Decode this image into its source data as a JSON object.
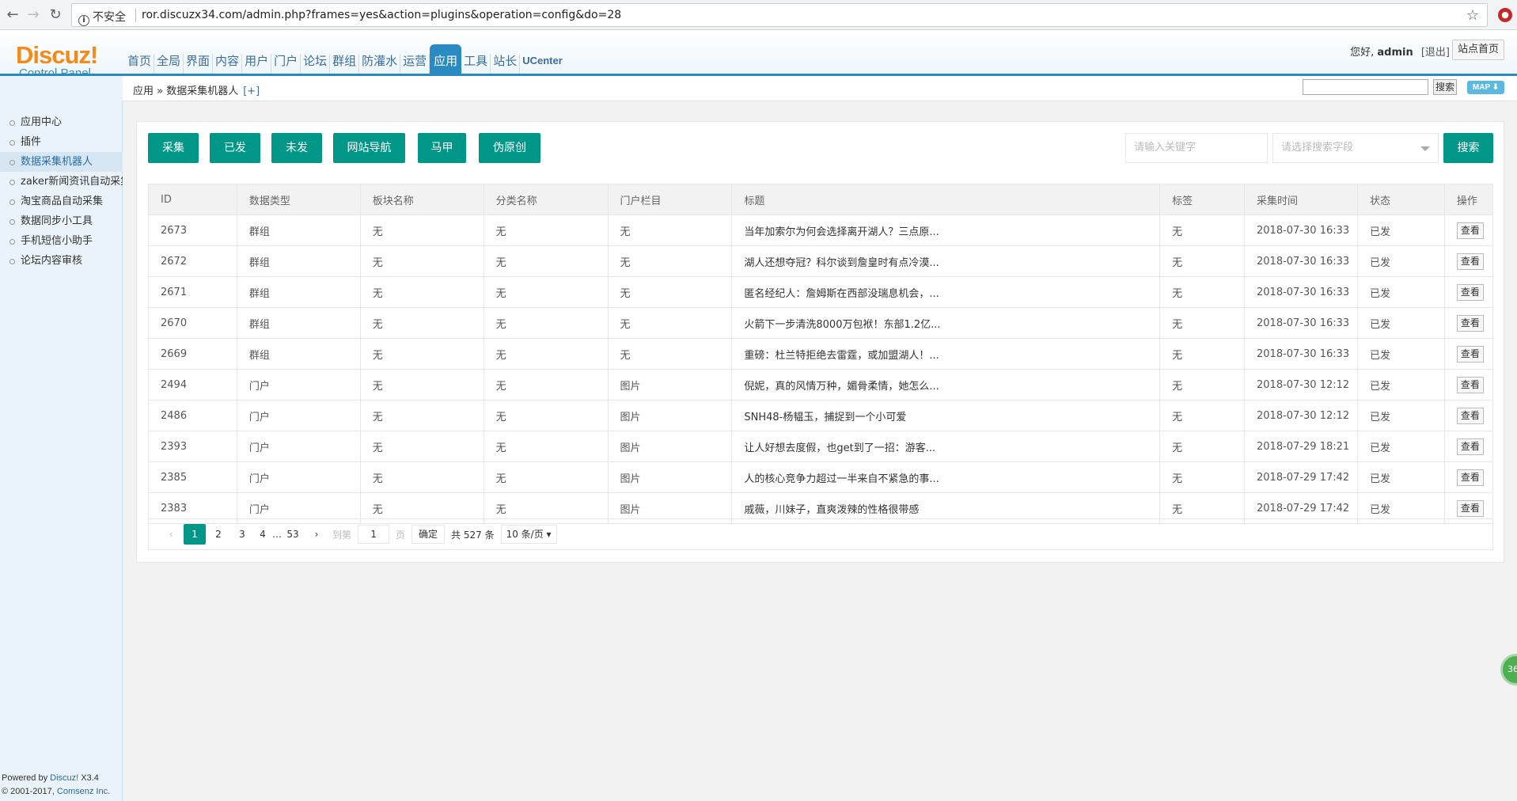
{
  "browser": {
    "back": "←",
    "forward": "→",
    "reload": "↻",
    "security_label": "不安全",
    "url": "ror.discuzx34.com/admin.php?frames=yes&action=plugins&operation=config&do=28",
    "star": "☆",
    "ext_icon": "●"
  },
  "header": {
    "logo_main": "Discuz!",
    "logo_sub": "Control Panel",
    "nav": [
      "首页",
      "全局",
      "界面",
      "内容",
      "用户",
      "门户",
      "论坛",
      "群组",
      "防灌水",
      "运营",
      "应用",
      "工具",
      "站长",
      "UCenter"
    ],
    "nav_active": "应用",
    "greeting_prefix": "您好,",
    "username": "admin",
    "logout": "[退出]",
    "site_home": "站点首页"
  },
  "breadcrumb": {
    "text": "应用 » 数据采集机器人",
    "add": "[+]",
    "search_button": "搜索",
    "map_button": "MAP ⬇"
  },
  "sidebar": {
    "items": [
      "应用中心",
      "插件",
      "数据采集机器人",
      "zaker新闻资讯自动采集",
      "淘宝商品自动采集",
      "数据同步小工具",
      "手机短信小助手",
      "论坛内容审核"
    ],
    "active_index": 2,
    "footer_line1_prefix": "Powered by ",
    "footer_line1_link": "Discuz!",
    "footer_line1_suffix": " X3.4",
    "footer_line2_prefix": "© 2001-2017, ",
    "footer_line2_link": "Comsenz Inc."
  },
  "toolbar": {
    "buttons": [
      "采集",
      "已发",
      "未发",
      "网站导航",
      "马甲",
      "伪原创"
    ],
    "keyword_placeholder": "请输入关键字",
    "field_placeholder": "请选择搜索字段",
    "search_label": "搜索"
  },
  "table": {
    "columns": [
      "ID",
      "数据类型",
      "板块名称",
      "分类名称",
      "门户栏目",
      "标题",
      "标签",
      "采集时间",
      "状态",
      "操作"
    ],
    "rows": [
      [
        "2673",
        "群组",
        "无",
        "无",
        "无",
        "当年加索尔为何会选择离开湖人？三点原...",
        "无",
        "2018-07-30 16:33",
        "已发",
        "查看"
      ],
      [
        "2672",
        "群组",
        "无",
        "无",
        "无",
        "湖人还想夺冠？科尔谈到詹皇时有点冷漠...",
        "无",
        "2018-07-30 16:33",
        "已发",
        "查看"
      ],
      [
        "2671",
        "群组",
        "无",
        "无",
        "无",
        "匿名经纪人：詹姆斯在西部没瑞息机会，...",
        "无",
        "2018-07-30 16:33",
        "已发",
        "查看"
      ],
      [
        "2670",
        "群组",
        "无",
        "无",
        "无",
        "火箭下一步清洗8000万包袱！东部1.2亿...",
        "无",
        "2018-07-30 16:33",
        "已发",
        "查看"
      ],
      [
        "2669",
        "群组",
        "无",
        "无",
        "无",
        "重磅：杜兰特拒绝去雷霆，或加盟湖人！...",
        "无",
        "2018-07-30 16:33",
        "已发",
        "查看"
      ],
      [
        "2494",
        "门户",
        "无",
        "无",
        "图片",
        "倪妮，真的风情万种，媚骨柔情，她怎么...",
        "无",
        "2018-07-30 12:12",
        "已发",
        "查看"
      ],
      [
        "2486",
        "门户",
        "无",
        "无",
        "图片",
        "SNH48-杨韫玉，捕捉到一个小可爱",
        "无",
        "2018-07-30 12:12",
        "已发",
        "查看"
      ],
      [
        "2393",
        "门户",
        "无",
        "无",
        "图片",
        "让人好想去度假，也get到了一招：游客...",
        "无",
        "2018-07-29 18:21",
        "已发",
        "查看"
      ],
      [
        "2385",
        "门户",
        "无",
        "无",
        "图片",
        "人的核心竞争力超过一半来自不紧急的事...",
        "无",
        "2018-07-29 17:42",
        "已发",
        "查看"
      ],
      [
        "2383",
        "门户",
        "无",
        "无",
        "图片",
        "戚薇，川妹子，直爽泼辣的性格很带感",
        "无",
        "2018-07-29 17:42",
        "已发",
        "查看"
      ]
    ]
  },
  "pager": {
    "prev": "‹",
    "pages": [
      "1",
      "2",
      "3",
      "4"
    ],
    "ellipsis": "…",
    "last": "53",
    "next": "›",
    "goto_label": "到第",
    "goto_value": "1",
    "page_unit": "页",
    "confirm": "确定",
    "total": "共 527 条",
    "per_page": "10 条/页 ▾"
  },
  "float_ball": "36"
}
